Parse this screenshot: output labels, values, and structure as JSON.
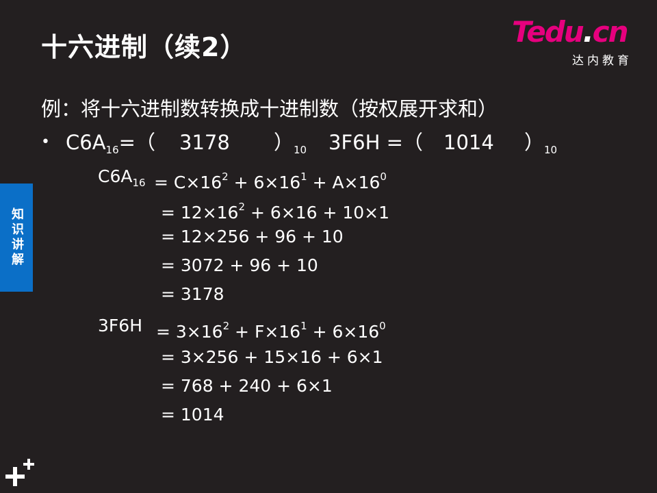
{
  "title": "十六进制（续2）",
  "logo": {
    "brand_te": "Te",
    "brand_du": "du",
    "brand_dot": ".",
    "brand_cn": "cn",
    "subtitle": "达内教育"
  },
  "example": "例：将十六进制数转换成十进制数（按权展开求和）",
  "bullet": {
    "bullet_char": "•",
    "left_expr": "C6A",
    "left_base": "16",
    "left_open": "=（",
    "left_answer": "3178",
    "left_close": "）",
    "left_result_base": "10",
    "right_expr": "3F6H =（",
    "right_answer": "1014",
    "right_close": "）",
    "right_result_base": "10"
  },
  "calc1": {
    "label": "C6A",
    "label_base": "16",
    "line1": {
      "a": "= C×16",
      "a_exp": "2",
      "b": " + 6×16",
      "b_exp": "1",
      "c": " +  A×16",
      "c_exp": "0"
    },
    "line2": {
      "a": "=  12×16",
      "a_exp": "2",
      "b": " + 6×16 +  10×1"
    },
    "line3": "=  12×256 + 96 +  10",
    "line4": "=  3072 + 96 +  10",
    "line5": "=  3178"
  },
  "calc2": {
    "label": "3F6H",
    "line1": {
      "a": "= 3×16",
      "a_exp": "2",
      "b": " + F×16",
      "b_exp": "1",
      "c": " +  6×16",
      "c_exp": "0"
    },
    "line2": "=  3×256 + 15×16 +  6×1",
    "line3": "=  768 + 240 +  6×1",
    "line4": "=  1014"
  },
  "side_tab": "知识讲解",
  "colors": {
    "background": "#231f20",
    "accent_blue": "#0b6fc7",
    "brand_pink": "#e6007e"
  },
  "icons": {
    "corner": "plus-plus-icon"
  }
}
